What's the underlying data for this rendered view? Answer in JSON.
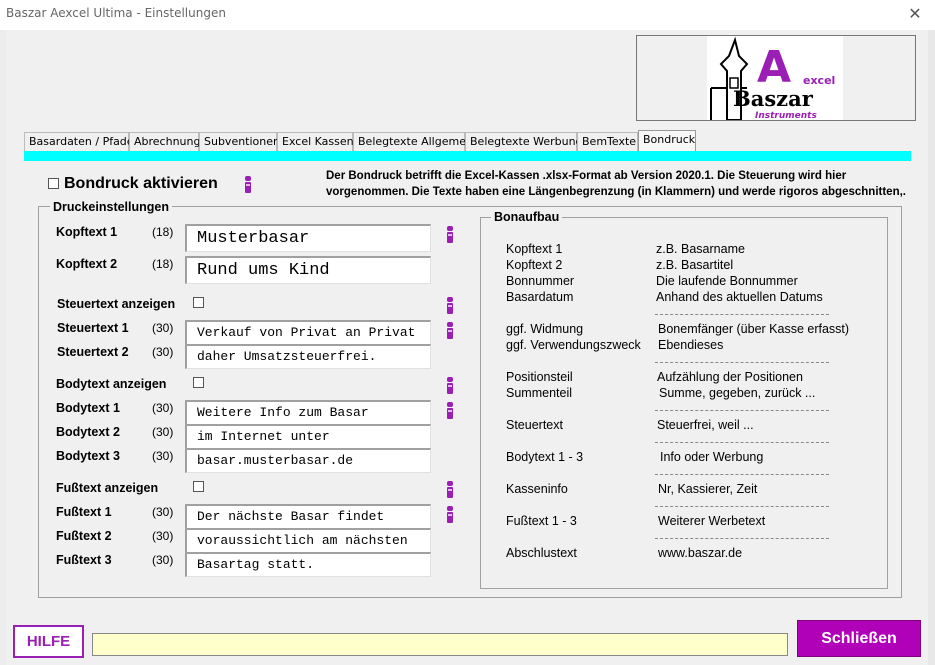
{
  "window": {
    "title": "Baszar Aexcel Ultima - Einstellungen",
    "close_glyph": "✕"
  },
  "logo": {
    "letter": "A",
    "word1": "excel",
    "word2": "Baszar",
    "word3": "Instruments"
  },
  "tabs": [
    {
      "label": "Basardaten / Pfade"
    },
    {
      "label": "Abrechnung"
    },
    {
      "label": "Subventionen"
    },
    {
      "label": "Excel Kassen"
    },
    {
      "label": "Belegtexte Allgemein"
    },
    {
      "label": "Belegtexte Werbung"
    },
    {
      "label": "BemTexte"
    },
    {
      "label": "Bondruck"
    }
  ],
  "bondruck": {
    "activate_label": "Bondruck aktivieren",
    "hint": "Der Bondruck betrifft die Excel-Kassen .xlsx-Format ab Version 2020.1. Die Steuerung wird hier vorgenommen. Die Texte haben eine Längenbegrenzung (in Klammern) und werde rigoros abgeschnitten,.",
    "druck_title": "Druckeinstellungen",
    "kopf1": {
      "label": "Kopftext 1",
      "limit": "(18)",
      "value": "Musterbasar"
    },
    "kopf2": {
      "label": "Kopftext 2",
      "limit": "(18)",
      "value": "Rund ums Kind"
    },
    "steuer_show": "Steuertext anzeigen",
    "steuer1": {
      "label": "Steuertext 1",
      "limit": "(30)",
      "value": "Verkauf von Privat an Privat"
    },
    "steuer2": {
      "label": "Steuertext 2",
      "limit": "(30)",
      "value": "daher Umsatzsteuerfrei."
    },
    "body_show": "Bodytext anzeigen",
    "body1": {
      "label": "Bodytext 1",
      "limit": "(30)",
      "value": "Weitere Info zum Basar"
    },
    "body2": {
      "label": "Bodytext 2",
      "limit": "(30)",
      "value": "im Internet unter"
    },
    "body3": {
      "label": "Bodytext 3",
      "limit": "(30)",
      "value": "basar.musterbasar.de"
    },
    "fuss_show": "Fußtext anzeigen",
    "fuss1": {
      "label": "Fußtext 1",
      "limit": "(30)",
      "value": "Der nächste Basar findet"
    },
    "fuss2": {
      "label": "Fußtext 2",
      "limit": "(30)",
      "value": "voraussichtlich am nächsten"
    },
    "fuss3": {
      "label": "Fußtext 3",
      "limit": "(30)",
      "value": "Basartag statt."
    }
  },
  "bonaufbau": {
    "title": "Bonaufbau",
    "separator": "--------------------------------------",
    "rows": [
      {
        "left": "Kopftext 1",
        "right": "z.B. Basarname"
      },
      {
        "left": "Kopftext 2",
        "right": "z.B. Basartitel"
      },
      {
        "left": "Bonnummer",
        "right": "Die laufende Bonnummer"
      },
      {
        "left": "Basardatum",
        "right": "Anhand des aktuellen Datums"
      },
      {
        "left": "ggf. Widmung",
        "right": "Bonemfänger (über Kasse erfasst)"
      },
      {
        "left": "ggf. Verwendungszweck",
        "right": "Ebendieses"
      },
      {
        "left": "Positionsteil",
        "right": "Aufzählung der Positionen"
      },
      {
        "left": "Summenteil",
        "right": "Summe, gegeben, zurück ..."
      },
      {
        "left": "Steuertext",
        "right": "Steuerfrei, weil ..."
      },
      {
        "left": "Bodytext 1 - 3",
        "right": "Info oder Werbung"
      },
      {
        "left": "Kasseninfo",
        "right": "Nr, Kassierer, Zeit"
      },
      {
        "left": "Fußtext 1 - 3",
        "right": "Weiterer Werbetext"
      },
      {
        "left": "Abschlustext",
        "right": "www.baszar.de"
      }
    ]
  },
  "footer": {
    "help_label": "HILFE",
    "status_text": "",
    "close_label": "Schließen"
  },
  "colors": {
    "accent": "#9b1fb5",
    "cyan": "#00ffff",
    "status_bg": "#ffffcc"
  }
}
